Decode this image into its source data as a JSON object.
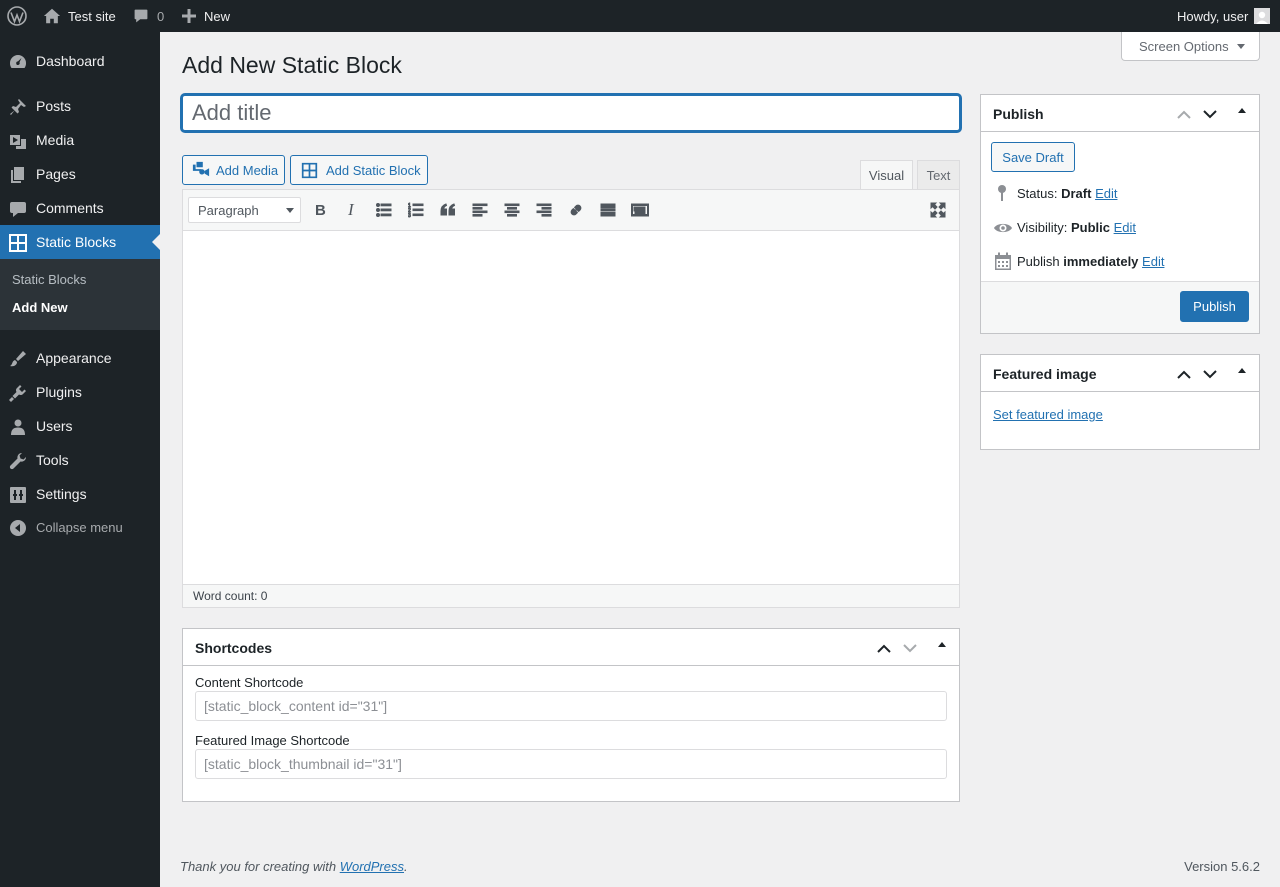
{
  "admin_bar": {
    "site_name": "Test site",
    "comments_count": "0",
    "new_label": "New",
    "greeting": "Howdy, user"
  },
  "sidebar": {
    "items": [
      {
        "label": "Dashboard",
        "icon": "dashboard-icon"
      },
      {
        "label": "Posts",
        "icon": "pin-icon"
      },
      {
        "label": "Media",
        "icon": "media-icon"
      },
      {
        "label": "Pages",
        "icon": "pages-icon"
      },
      {
        "label": "Comments",
        "icon": "comments-icon"
      },
      {
        "label": "Static Blocks",
        "icon": "grid-icon"
      },
      {
        "label": "Appearance",
        "icon": "brush-icon"
      },
      {
        "label": "Plugins",
        "icon": "plugin-icon"
      },
      {
        "label": "Users",
        "icon": "users-icon"
      },
      {
        "label": "Tools",
        "icon": "wrench-icon"
      },
      {
        "label": "Settings",
        "icon": "settings-icon"
      }
    ],
    "submenu": [
      "Static Blocks",
      "Add New"
    ],
    "collapse_label": "Collapse menu"
  },
  "screen_options_label": "Screen Options",
  "page_title": "Add New Static Block",
  "title_input": {
    "placeholder": "Add title",
    "value": ""
  },
  "media_buttons": {
    "add_media": "Add Media",
    "add_static_block": "Add Static Block"
  },
  "editor": {
    "tabs": [
      "Visual",
      "Text"
    ],
    "active_tab": "Visual",
    "format_select": "Paragraph",
    "word_count": "Word count: 0"
  },
  "publish_box": {
    "title": "Publish",
    "save_draft": "Save Draft",
    "status_label": "Status:",
    "status_value": "Draft",
    "visibility_label": "Visibility:",
    "visibility_value": "Public",
    "publish_label": "Publish",
    "publish_value": "immediately",
    "edit_link": "Edit",
    "publish_button": "Publish"
  },
  "featured_image_box": {
    "title": "Featured image",
    "link": "Set featured image"
  },
  "shortcodes_box": {
    "title": "Shortcodes",
    "content_label": "Content Shortcode",
    "content_value": "[static_block_content id=\"31\"]",
    "image_label": "Featured Image Shortcode",
    "image_value": "[static_block_thumbnail id=\"31\"]"
  },
  "footer": {
    "thanks_prefix": "Thank you for creating with ",
    "thanks_link": "WordPress",
    "thanks_suffix": ".",
    "version": "Version 5.6.2"
  },
  "colors": {
    "accent": "#2271b1",
    "sidebar_bg": "#1d2327",
    "page_bg": "#f0f0f1"
  }
}
